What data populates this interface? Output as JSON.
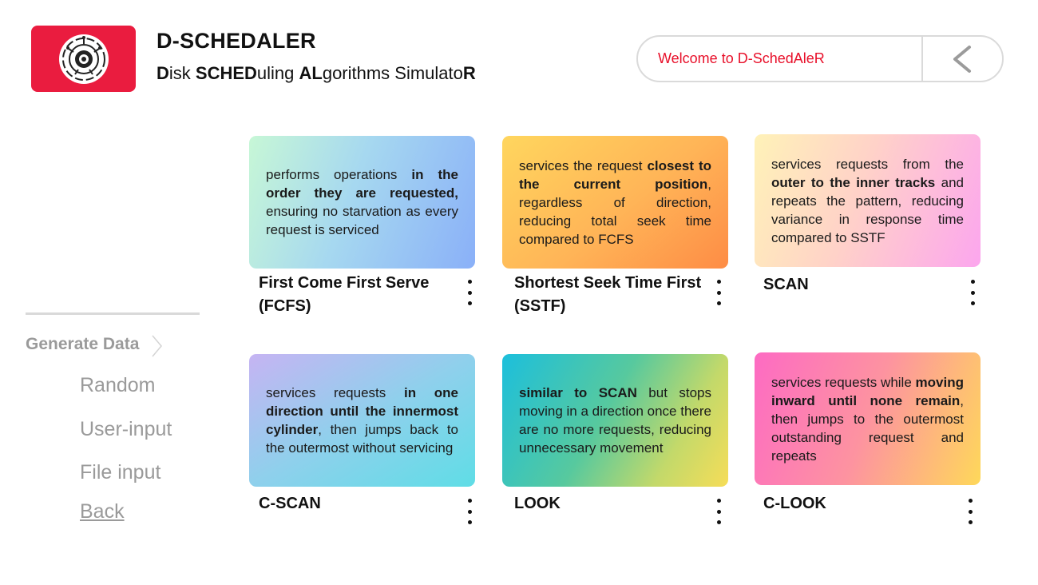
{
  "header": {
    "logo_icon": "disk-circuit-icon",
    "title": "D-SCHEDALER",
    "subtitle_parts": [
      "D",
      "isk ",
      "SCHED",
      "uling ",
      "AL",
      "gorithms Simulato",
      "R"
    ],
    "welcome_text": "Welcome to D-SchedAleR",
    "back_icon": "chevron-left-icon"
  },
  "sidebar": {
    "generate_label": "Generate Data",
    "items": [
      "Random",
      "User-input",
      "File input"
    ],
    "back_label": "Back"
  },
  "algorithms": [
    {
      "title": "First Come First Serve (FCFS)",
      "parts": [
        {
          "t": "performs operations ",
          "b": false
        },
        {
          "t": "in the order they are requested,",
          "b": true
        },
        {
          "t": " ensuring no starvation as every request is serviced",
          "b": false
        }
      ]
    },
    {
      "title": "Shortest Seek Time First (SSTF)",
      "parts": [
        {
          "t": "services the request ",
          "b": false
        },
        {
          "t": "closest to the current position",
          "b": true
        },
        {
          "t": ", regardless of direction, reducing total seek time compared to FCFS",
          "b": false
        }
      ]
    },
    {
      "title": "SCAN",
      "parts": [
        {
          "t": "services requests from the ",
          "b": false
        },
        {
          "t": "outer to the inner tracks",
          "b": true
        },
        {
          "t": " and repeats the pattern, reducing variance in response time compared to SSTF",
          "b": false
        }
      ]
    },
    {
      "title": "C-SCAN",
      "parts": [
        {
          "t": "services requests ",
          "b": false
        },
        {
          "t": "in one direction until the innermost cylinder",
          "b": true
        },
        {
          "t": ", then jumps back to the outermost without servicing",
          "b": false
        }
      ]
    },
    {
      "title": "LOOK",
      "parts": [
        {
          "t": "similar to SCAN",
          "b": true
        },
        {
          "t": " but stops moving in a direction once there are no more requests, reducing unnecessary movement",
          "b": false
        }
      ]
    },
    {
      "title": "C-LOOK",
      "parts": [
        {
          "t": "services requests while ",
          "b": false
        },
        {
          "t": "moving inward until none remain",
          "b": true
        },
        {
          "t": ", then jumps to the outermost outstanding request and repeats",
          "b": false
        }
      ]
    }
  ],
  "menu_icon": "more-vertical-icon",
  "colors": {
    "brand": "#ea1c3f",
    "welcome_text": "#e8102a",
    "muted": "#9a9a9a"
  }
}
